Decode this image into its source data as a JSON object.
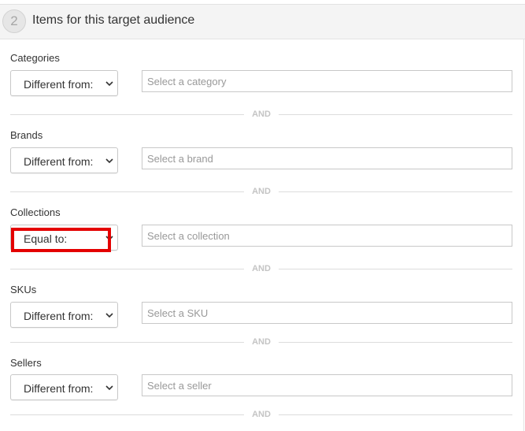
{
  "header": {
    "step_number": "2",
    "title": "Items for this target audience"
  },
  "operator_options": [
    "Different from:",
    "Equal to:"
  ],
  "rules": [
    {
      "label": "Categories",
      "operator": "Different from:",
      "placeholder": "Select a category"
    },
    {
      "label": "Brands",
      "operator": "Different from:",
      "placeholder": "Select a brand"
    },
    {
      "label": "Collections",
      "operator": "Equal to:",
      "placeholder": "Select a collection"
    },
    {
      "label": "SKUs",
      "operator": "Different from:",
      "placeholder": "Select a SKU"
    },
    {
      "label": "Sellers",
      "operator": "Different from:",
      "placeholder": "Select a seller"
    }
  ],
  "separator_label": "AND",
  "colors": {
    "highlight": "#e40000",
    "separator_text": "#c4c4c4",
    "header_bg": "#f4f4f4"
  }
}
